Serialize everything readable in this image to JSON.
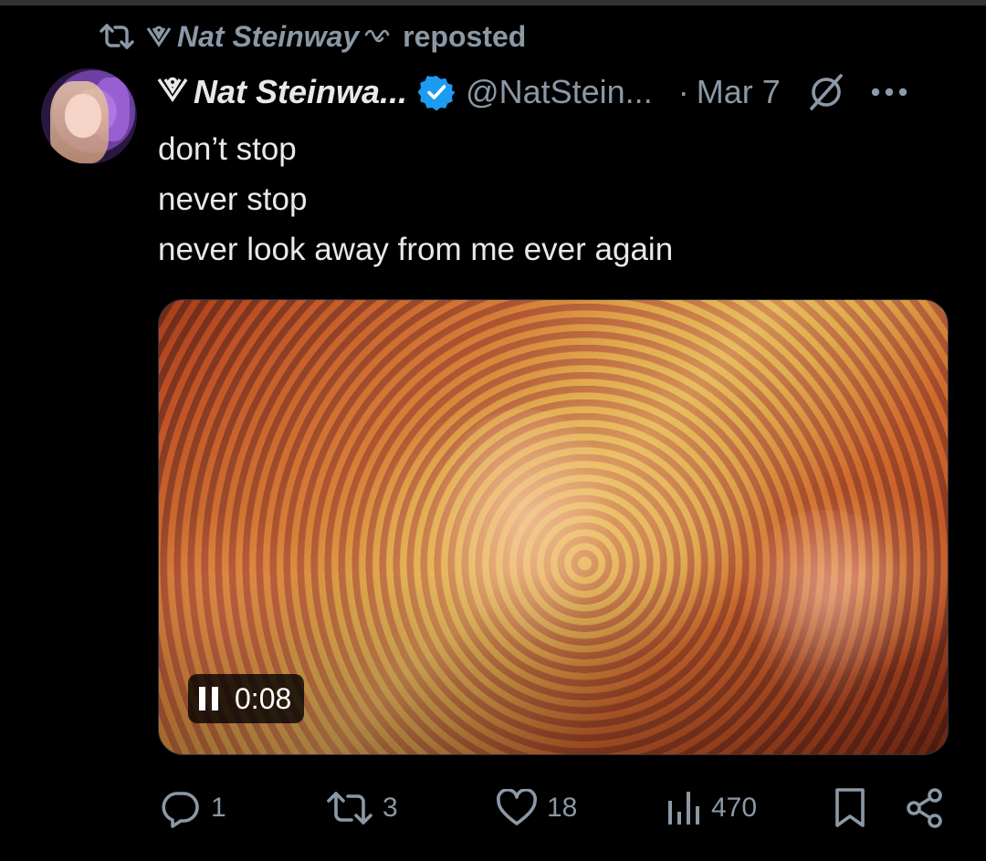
{
  "repost": {
    "reposter_name": "Nat Steinway",
    "label": "reposted"
  },
  "tweet": {
    "display_name": "Nat Steinwa...",
    "verified": true,
    "handle": "@NatStein...",
    "separator": "·",
    "date": "Mar 7",
    "lines": [
      "don’t stop",
      "never stop",
      "never look away from me ever again"
    ]
  },
  "media": {
    "type": "video",
    "state": "playing",
    "timestamp": "0:08"
  },
  "actions": {
    "replies": "1",
    "reposts": "3",
    "likes": "18",
    "views": "470"
  },
  "colors": {
    "background": "#000000",
    "text": "#e7e9ea",
    "muted": "#8b98a5",
    "verified": "#1d9bf0"
  },
  "icons": {
    "repost": "repost-icon",
    "verified": "verified-badge-icon",
    "grok": "grok-icon",
    "more": "more-icon",
    "reply": "reply-icon",
    "like": "heart-icon",
    "views": "views-icon",
    "bookmark": "bookmark-icon",
    "share": "share-icon",
    "pause": "pause-icon"
  }
}
